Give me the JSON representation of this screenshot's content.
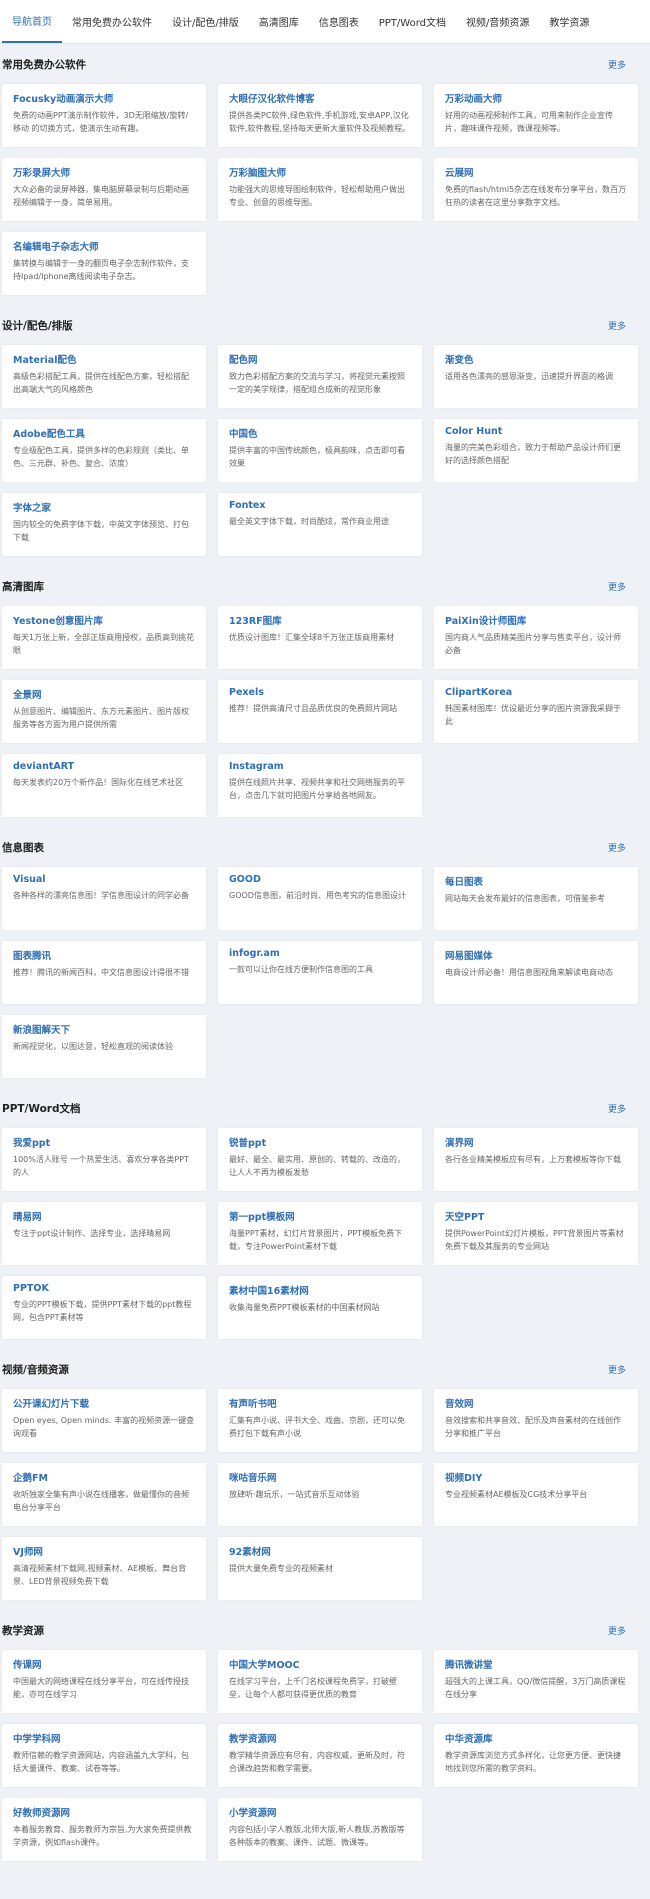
{
  "nav": {
    "tabs": [
      "导航首页",
      "常用免费办公软件",
      "设计/配色/排版",
      "高清图库",
      "信息图表",
      "PPT/Word文档",
      "视频/音频资源",
      "教学资源"
    ]
  },
  "more_label": "更多",
  "sections": [
    {
      "title": "常用免费办公软件",
      "cards": [
        {
          "name": "Focusky动画演示大师",
          "desc": "免费的动画PPT演示制作软件，3D无限缩放/旋转/移动 的切换方式，使演示生动有趣。"
        },
        {
          "name": "大眼仔汉化软件博客",
          "desc": "提供各类PC软件,绿色软件,手机游戏,安卓APP,汉化软件,软件教程,坚持每天更新大量软件及视频教程。"
        },
        {
          "name": "万彩动画大师",
          "desc": "好用的动画视频制作工具，可用来制作企业宣传片，趣味课件视频，微课视频等。"
        },
        {
          "name": "万彩录屏大师",
          "desc": "大众必备的录屏神器，集电脑屏幕录制与后期动画视频编辑于一身，简单易用。"
        },
        {
          "name": "万彩脑图大师",
          "desc": "功能强大的思维导图绘制软件，轻松帮助用户做出专业、创意的思维导图。"
        },
        {
          "name": "云展网",
          "desc": "免费的flash/html5杂志在线发布分享平台，数百万狂热的读者在这里分享数字文档。"
        },
        {
          "name": "名编辑电子杂志大师",
          "desc": "集转换与编辑于一身的翻页电子杂志制作软件，支持Ipad/Iphone离线阅读电子杂志。"
        }
      ]
    },
    {
      "title": "设计/配色/排版",
      "cards": [
        {
          "name": "Material配色",
          "desc": "高级色彩搭配工具，提供在线配色方案，轻松搭配出高端大气的风格颜色"
        },
        {
          "name": "配色网",
          "desc": "致力色彩搭配方案的交流与学习，将视觉元素按照一定的美学规律，搭配组合成新的视觉形象"
        },
        {
          "name": "渐变色",
          "desc": "适用各色漂亮的感恩渐变，迅速提升界面的格调"
        },
        {
          "name": "Adobe配色工具",
          "desc": "专业级配色工具，提供多样的色彩规则（类比、单色、三元群、补色、复合、浓度）"
        },
        {
          "name": "中国色",
          "desc": "提供丰富的中国传统颜色，极具韵味，点击即可看效果"
        },
        {
          "name": "Color Hunt",
          "desc": "海量的完美色彩组合，致力于帮助产品设计师们更好的选择颜色搭配"
        },
        {
          "name": "字体之家",
          "desc": "国内较全的免费字体下载，中英文字体预览、打包下载"
        },
        {
          "name": "Fontex",
          "desc": "最全英文字体下载，时尚酷炫，常作商业用途"
        }
      ]
    },
    {
      "title": "高清图库",
      "cards": [
        {
          "name": "Yestone创意图片库",
          "desc": "每天1万张上新，全部正版商用授权，品质高到挑花眼"
        },
        {
          "name": "123RF图库",
          "desc": "优质设计图库！汇集全球8千万张正版商用素材"
        },
        {
          "name": "PaiXin设计师图库",
          "desc": "国内商人气品质精美图片分享与售卖平台，设计师必备"
        },
        {
          "name": "全景网",
          "desc": "从创意图片、编辑图片、东方元素图片、图片版权服务等各方面为用户提供所需"
        },
        {
          "name": "Pexels",
          "desc": "推荐！提供高清尺寸且品质优良的免费照片网站"
        },
        {
          "name": "ClipartKorea",
          "desc": "韩国素材图库！优设最近分享的图片资源我采撷于此"
        },
        {
          "name": "deviantART",
          "desc": "每天发表约20万个新作品！国际化在线艺术社区"
        },
        {
          "name": "Instagram",
          "desc": "提供在线照片共享、视频共享和社交网络服务的平台，点击几下就可把图片分享给各地网友。"
        }
      ]
    },
    {
      "title": "信息图表",
      "cards": [
        {
          "name": "Visual",
          "desc": "各种各样的漂亮信息图！学信息图设计的同学必备"
        },
        {
          "name": "GOOD",
          "desc": "GOOD信息图，前沿时尚、用色考究的信息图设计"
        },
        {
          "name": "每日图表",
          "desc": "网站每天会发布最好的信息图表，可借鉴参考"
        },
        {
          "name": "图表腾讯",
          "desc": "推荐！腾讯的新闻百科，中文信息图设计得很不错"
        },
        {
          "name": "infogr.am",
          "desc": "一款可以让你在线方便制作信息图的工具"
        },
        {
          "name": "网易图媒体",
          "desc": "电商设计师必备！用信息图视角来解读电商动态"
        },
        {
          "name": "新浪图解天下",
          "desc": "新闻视觉化，以图达意，轻松直观的阅读体验"
        }
      ]
    },
    {
      "title": "PPT/Word文档",
      "cards": [
        {
          "name": "我爱ppt",
          "desc": "100%活人账号 一个热爱生活、喜欢分享各类PPT的人"
        },
        {
          "name": "锐普ppt",
          "desc": "最好、最全、最实用、原创的、转载的、改造的，让人人不再为模板发愁"
        },
        {
          "name": "演界网",
          "desc": "各行各业精美模板应有尽有，上万套模板等你下载"
        },
        {
          "name": "晴易网",
          "desc": "专注于ppt设计制作、选择专业，选择晴易网"
        },
        {
          "name": "第一ppt模板网",
          "desc": "海量PPT素材，幻灯片背景图片，PPT模板免费下载，专注PowerPoint素材下载"
        },
        {
          "name": "天空PPT",
          "desc": "提供PowerPoint幻灯片模板，PPT背景图片等素材免费下载及其服务的专业网站"
        },
        {
          "name": "PPTOK",
          "desc": "专业的PPT模板下载，提供PPT素材下载的ppt教程网，包含PPT素材等"
        },
        {
          "name": "素材中国16素材网",
          "desc": "收集海量免费PPT模板素材的中国素材网站"
        }
      ]
    },
    {
      "title": "视频/音频资源",
      "cards": [
        {
          "name": "公开课幻灯片下载",
          "desc": "Open eyes, Open minds. 丰富的视频资源一键查询观看"
        },
        {
          "name": "有声听书吧",
          "desc": "汇集有声小说、评书大全、戏曲、京剧，还可以免费打包下载有声小说"
        },
        {
          "name": "音效网",
          "desc": "音效搜索和共享音效、配乐及声音素材的在线创作分享和推广平台"
        },
        {
          "name": "企鹅FM",
          "desc": "收听独家全集有声小说在线播客，做最懂你的音频电台分享平台"
        },
        {
          "name": "咪咕音乐网",
          "desc": "放肆听·趣玩乐，一站式音乐互动体验"
        },
        {
          "name": "视频DIY",
          "desc": "专业视频素材AE模板及CG技术分享平台"
        },
        {
          "name": "VJ师网",
          "desc": "高清视频素材下载网,视频素材、AE模板、舞台背景、LED背景视频免费下载"
        },
        {
          "name": "92素材网",
          "desc": "提供大量免费专业的视频素材"
        }
      ]
    },
    {
      "title": "教学资源",
      "cards": [
        {
          "name": "传课网",
          "desc": "中国最大的网络课程在线分享平台，可在线传授技能，亦可在线学习"
        },
        {
          "name": "中国大学MOOC",
          "desc": "在线学习平台，上千门名校课程免费学，打破壁垒，让每个人都可获得更优质的教育"
        },
        {
          "name": "腾讯微讲堂",
          "desc": "超强大的上课工具，QQ/微信提醒，3万门高质课程在线分享"
        },
        {
          "name": "中学学科网",
          "desc": "教师信赖的教学资源网站，内容涵盖九大学科，包括大量课件、教案、试卷等等。"
        },
        {
          "name": "教学资源网",
          "desc": "教学精华资源应有尽有，内容权威，更新及时，符合课改趋势和教学需要。"
        },
        {
          "name": "中华资源库",
          "desc": "教学资源库浏览方式多样化，让您更方便、更快捷地找到您所需的教学资料。"
        },
        {
          "name": "好教师资源网",
          "desc": "本着服务教育、服务教师为宗旨,为大家免费提供教学资源，例如flash课件。"
        },
        {
          "name": "小学资源网",
          "desc": "内容包括小学人教版,北师大版,新人教版,苏教版等各种版本的教案、课件、试题、微课等。"
        }
      ]
    }
  ]
}
